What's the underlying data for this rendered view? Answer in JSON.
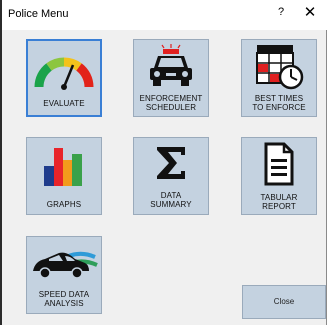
{
  "window": {
    "title": "Police Menu",
    "help_label": "?",
    "close_glyph": "✕"
  },
  "tiles": [
    {
      "id": "evaluate",
      "label_line1": "EVALUATE",
      "label_line2": "",
      "icon": "gauge-icon"
    },
    {
      "id": "enforcement-scheduler",
      "label_line1": "ENFORCEMENT",
      "label_line2": "SCHEDULER",
      "icon": "police-car-icon"
    },
    {
      "id": "best-times",
      "label_line1": "BEST TIMES",
      "label_line2": "TO ENFORCE",
      "icon": "calendar-clock-icon"
    },
    {
      "id": "graphs",
      "label_line1": "GRAPHS",
      "label_line2": "",
      "icon": "bar-chart-icon"
    },
    {
      "id": "data-summary",
      "label_line1": "DATA",
      "label_line2": "SUMMARY",
      "icon": "sigma-icon"
    },
    {
      "id": "tabular-report",
      "label_line1": "TABULAR",
      "label_line2": "REPORT",
      "icon": "document-icon"
    },
    {
      "id": "speed-data-analysis",
      "label_line1": "SPEED DATA",
      "label_line2": "ANALYSIS",
      "icon": "speeding-car-icon"
    }
  ],
  "close_button": {
    "label": "Close"
  },
  "colors": {
    "tile_bg": "#c4d2e0",
    "selected_border": "#3a7fd5",
    "siren_red": "#e02020",
    "chart_red": "#e8242a",
    "chart_orange": "#f39a1c",
    "chart_green": "#3aa14a",
    "chart_navy": "#1f3c8c"
  }
}
